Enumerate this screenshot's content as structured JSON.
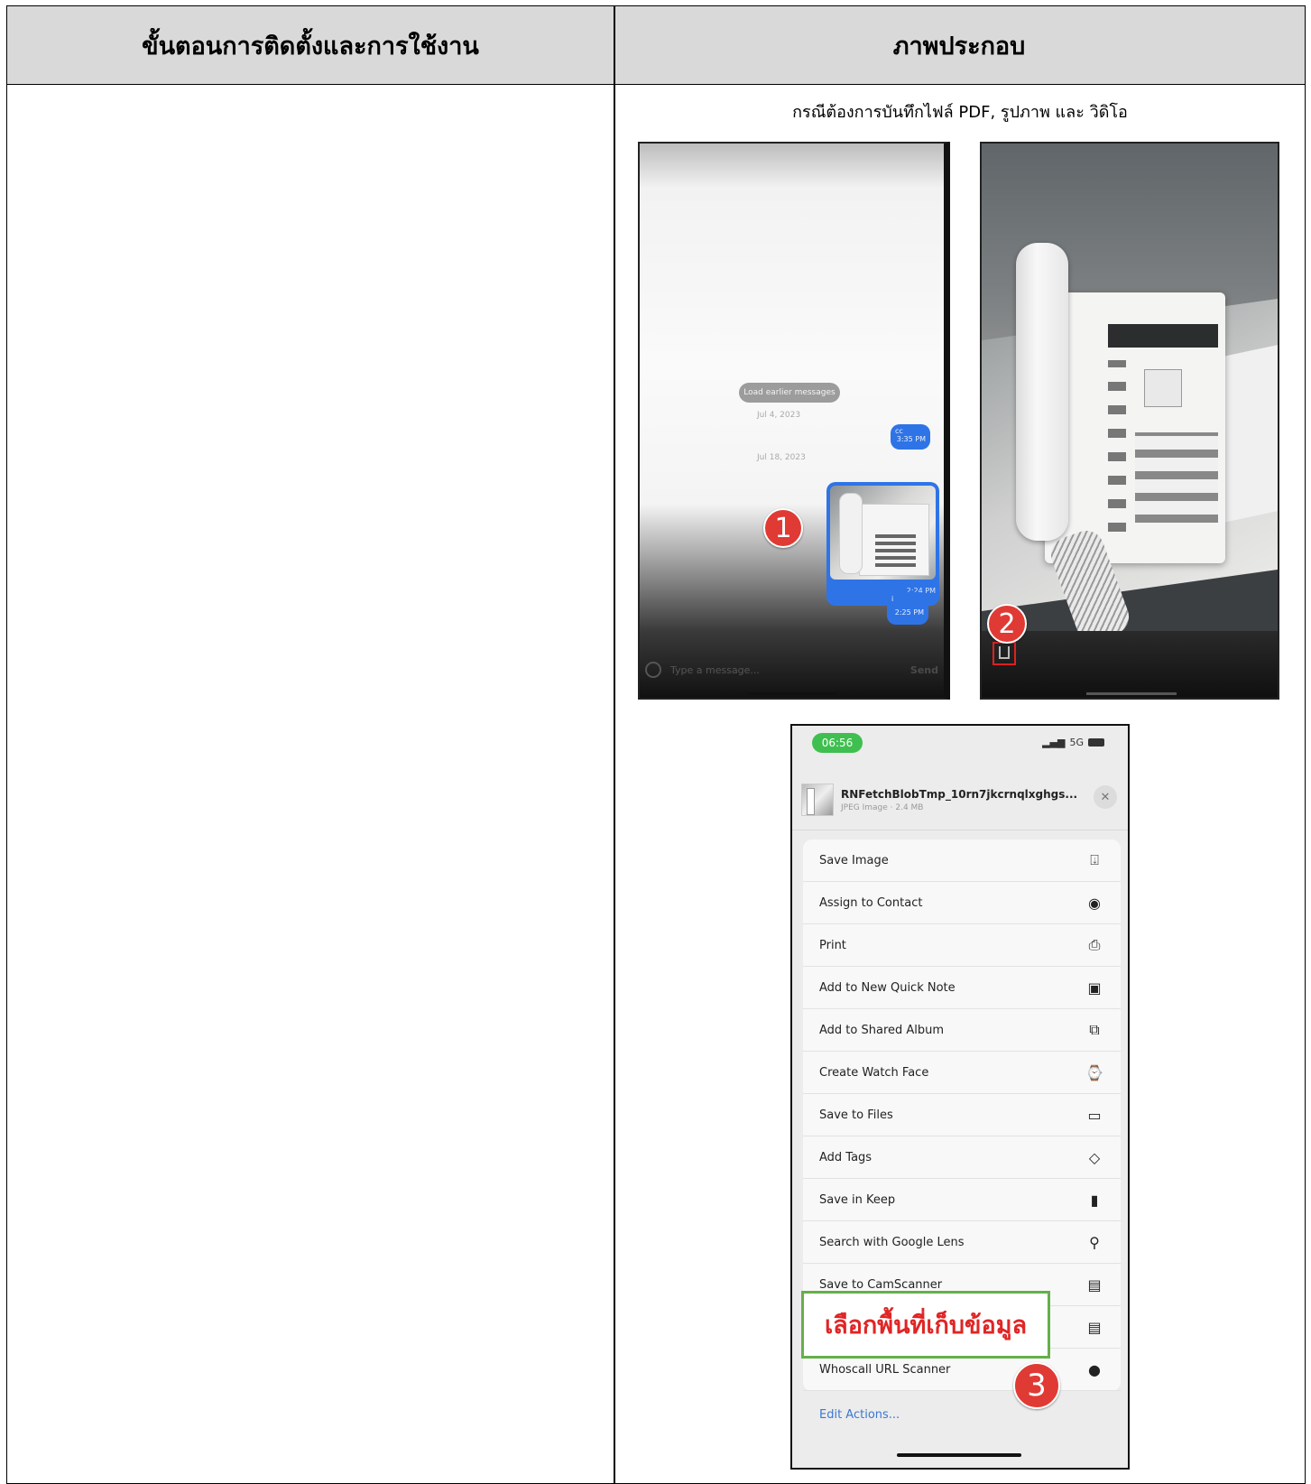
{
  "table": {
    "header_left": "ขั้นตอนการติดตั้งและการใช้งาน",
    "header_right": "ภาพประกอบ"
  },
  "caption": "กรณีต้องการบันทึกไฟล์ PDF, รูปภาพ และ วิดิโอ",
  "screenshot1": {
    "system_bubble": "Load earlier messages",
    "date1": "Jul 4, 2023",
    "bubble1_text": "cc",
    "bubble1_time": "3:35 PM",
    "date2": "Jul 18, 2023",
    "photo_time": "2:24 PM",
    "bubble2_text": "i",
    "bubble2_time": "2:25 PM",
    "input_placeholder": "Type a message...",
    "send_label": "Send",
    "marker": "1"
  },
  "screenshot2": {
    "marker": "2"
  },
  "screenshot3": {
    "time": "06:56",
    "network": "5G",
    "file_title": "RNFetchBlobTmp_10rn7jkcrnqlxghgs...",
    "file_sub": "JPEG Image · 2.4 MB",
    "actions": [
      {
        "label": "Save Image",
        "icon": "⍗"
      },
      {
        "label": "Assign to Contact",
        "icon": "◉"
      },
      {
        "label": "Print",
        "icon": "⎙"
      },
      {
        "label": "Add to New Quick Note",
        "icon": "▣"
      },
      {
        "label": "Add to Shared Album",
        "icon": "⧉"
      },
      {
        "label": "Create Watch Face",
        "icon": "⌚"
      },
      {
        "label": "Save to Files",
        "icon": "▭"
      },
      {
        "label": "Add Tags",
        "icon": "◇"
      },
      {
        "label": "Save in Keep",
        "icon": "▮"
      },
      {
        "label": "Search with Google Lens",
        "icon": "⚲"
      },
      {
        "label": "Save to CamScanner",
        "icon": "▤"
      },
      {
        "label": "",
        "icon": "▤"
      },
      {
        "label": "Whoscall URL Scanner",
        "icon": "●"
      }
    ],
    "edit_actions": "Edit Actions...",
    "marker": "3"
  },
  "callout": "เลือกพื้นที่เก็บข้อมูล"
}
